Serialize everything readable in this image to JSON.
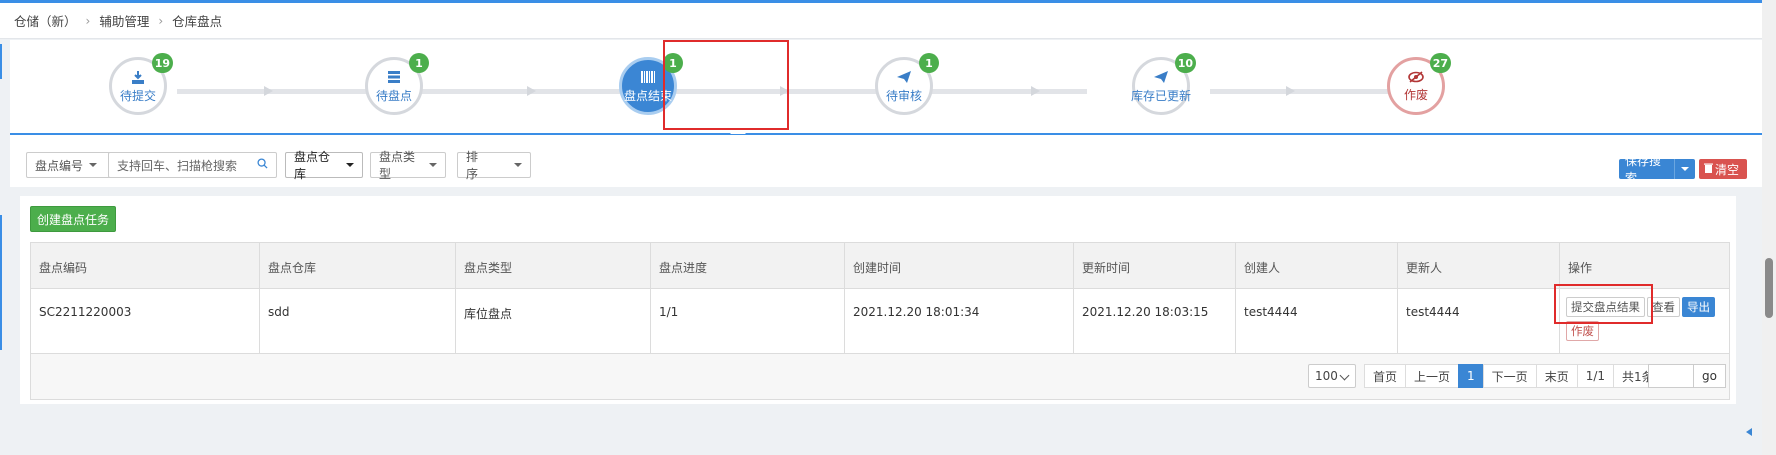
{
  "breadcrumb": [
    "仓储（新）",
    "辅助管理",
    "仓库盘点"
  ],
  "steps": [
    {
      "label": "待提交",
      "count": "19",
      "icon": "download-icon",
      "state": "normal"
    },
    {
      "label": "待盘点",
      "count": "1",
      "icon": "list-icon",
      "state": "normal"
    },
    {
      "label": "盘点结束",
      "count": "1",
      "icon": "barcode-icon",
      "state": "active"
    },
    {
      "label": "待审核",
      "count": "1",
      "icon": "paper-plane-icon",
      "state": "normal"
    },
    {
      "label": "库存已更新",
      "count": "10",
      "icon": "paper-plane-icon",
      "state": "normal"
    },
    {
      "label": "作废",
      "count": "27",
      "icon": "eye-slash-icon",
      "state": "void"
    }
  ],
  "filters": {
    "code_select": "盘点编号",
    "search_placeholder": "支持回车、扫描枪搜索",
    "warehouse_select": "盘点仓库",
    "type_select": "盘点类型",
    "sort_select": "排序",
    "save_search": "保存搜索",
    "clear": "清空"
  },
  "create_button": "创建盘点任务",
  "table": {
    "headers": [
      "盘点编码",
      "盘点仓库",
      "盘点类型",
      "盘点进度",
      "创建时间",
      "更新时间",
      "创建人",
      "更新人",
      "操作"
    ],
    "rows": [
      {
        "code": "SC2211220003",
        "warehouse": "sdd",
        "type": "库位盘点",
        "progress": "1/1",
        "created": "2021.12.20 18:01:34",
        "updated": "2021.12.20 18:03:15",
        "creator": "test4444",
        "updater": "test4444",
        "actions": {
          "submit": "提交盘点结果",
          "view": "查看",
          "export": "导出",
          "void": "作废"
        }
      }
    ]
  },
  "pagination": {
    "page_size": "100",
    "first": "首页",
    "prev": "上一页",
    "current": "1",
    "next": "下一页",
    "last": "末页",
    "pages": "1/1",
    "total": "共1条",
    "go": "go"
  },
  "colors": {
    "accent": "#3a86d4",
    "success": "#4cae4c",
    "danger": "#d9534f",
    "highlight": "#e02b2b"
  }
}
